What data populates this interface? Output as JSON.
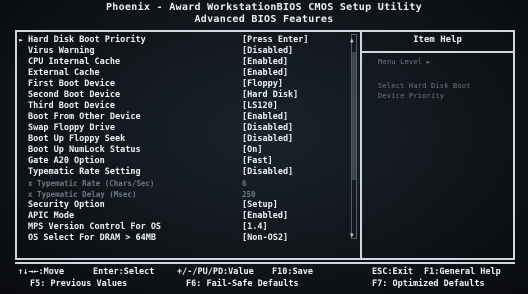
{
  "header": {
    "line1": "Phoenix - Award WorkstationBIOS CMOS Setup Utility",
    "line2": "Advanced BIOS Features"
  },
  "menu": {
    "rows": [
      {
        "label": "Hard Disk Boot Priority",
        "value": "[Press Enter]",
        "submenu": true
      },
      {
        "label": "Virus Warning",
        "value": "[Disabled]"
      },
      {
        "label": "CPU Internal Cache",
        "value": "[Enabled]"
      },
      {
        "label": "External Cache",
        "value": "[Enabled]"
      },
      {
        "label": "First Boot Device",
        "value": "[Floppy]"
      },
      {
        "label": "Second Boot Device",
        "value": "[Hard Disk]"
      },
      {
        "label": "Third Boot Device",
        "value": "[LS120]"
      },
      {
        "label": "Boot From Other Device",
        "value": "[Enabled]"
      },
      {
        "label": "Swap Floppy Drive",
        "value": "[Disabled]"
      },
      {
        "label": "Boot Up Floppy Seek",
        "value": "[Disabled]"
      },
      {
        "label": "Boot Up NumLock Status",
        "value": "[On]"
      },
      {
        "label": "Gate A20 Option",
        "value": "[Fast]"
      },
      {
        "label": "Typematic Rate Setting",
        "value": "[Disabled]"
      },
      {
        "label": "x Typematic Rate (Chars/Sec)",
        "value": "6",
        "disabled": true
      },
      {
        "label": "x Typematic Delay (Msec)",
        "value": "250",
        "disabled": true
      },
      {
        "label": "Security Option",
        "value": "[Setup]"
      },
      {
        "label": "APIC Mode",
        "value": "[Enabled]"
      },
      {
        "label": "MPS Version Control For OS",
        "value": "[1.4]"
      },
      {
        "label": "OS Select For DRAM > 64MB",
        "value": "[Non-OS2]"
      }
    ]
  },
  "help": {
    "title": "Item Help",
    "menu_level": "Menu Level   ►",
    "desc_line1": "Select Hard Disk Boot",
    "desc_line2": "Device Priority"
  },
  "footer": {
    "l1_move": "↑↓→←:Move",
    "l1_select": "Enter:Select",
    "l1_value": "+/-/PU/PD:Value",
    "l1_save": "F10:Save",
    "l1_exit": "ESC:Exit",
    "l1_help": "F1:General Help",
    "l2_prev": "F5: Previous Values",
    "l2_failsafe": "F6: Fail-Safe Defaults",
    "l2_optimized": "F7: Optimized Defaults"
  }
}
